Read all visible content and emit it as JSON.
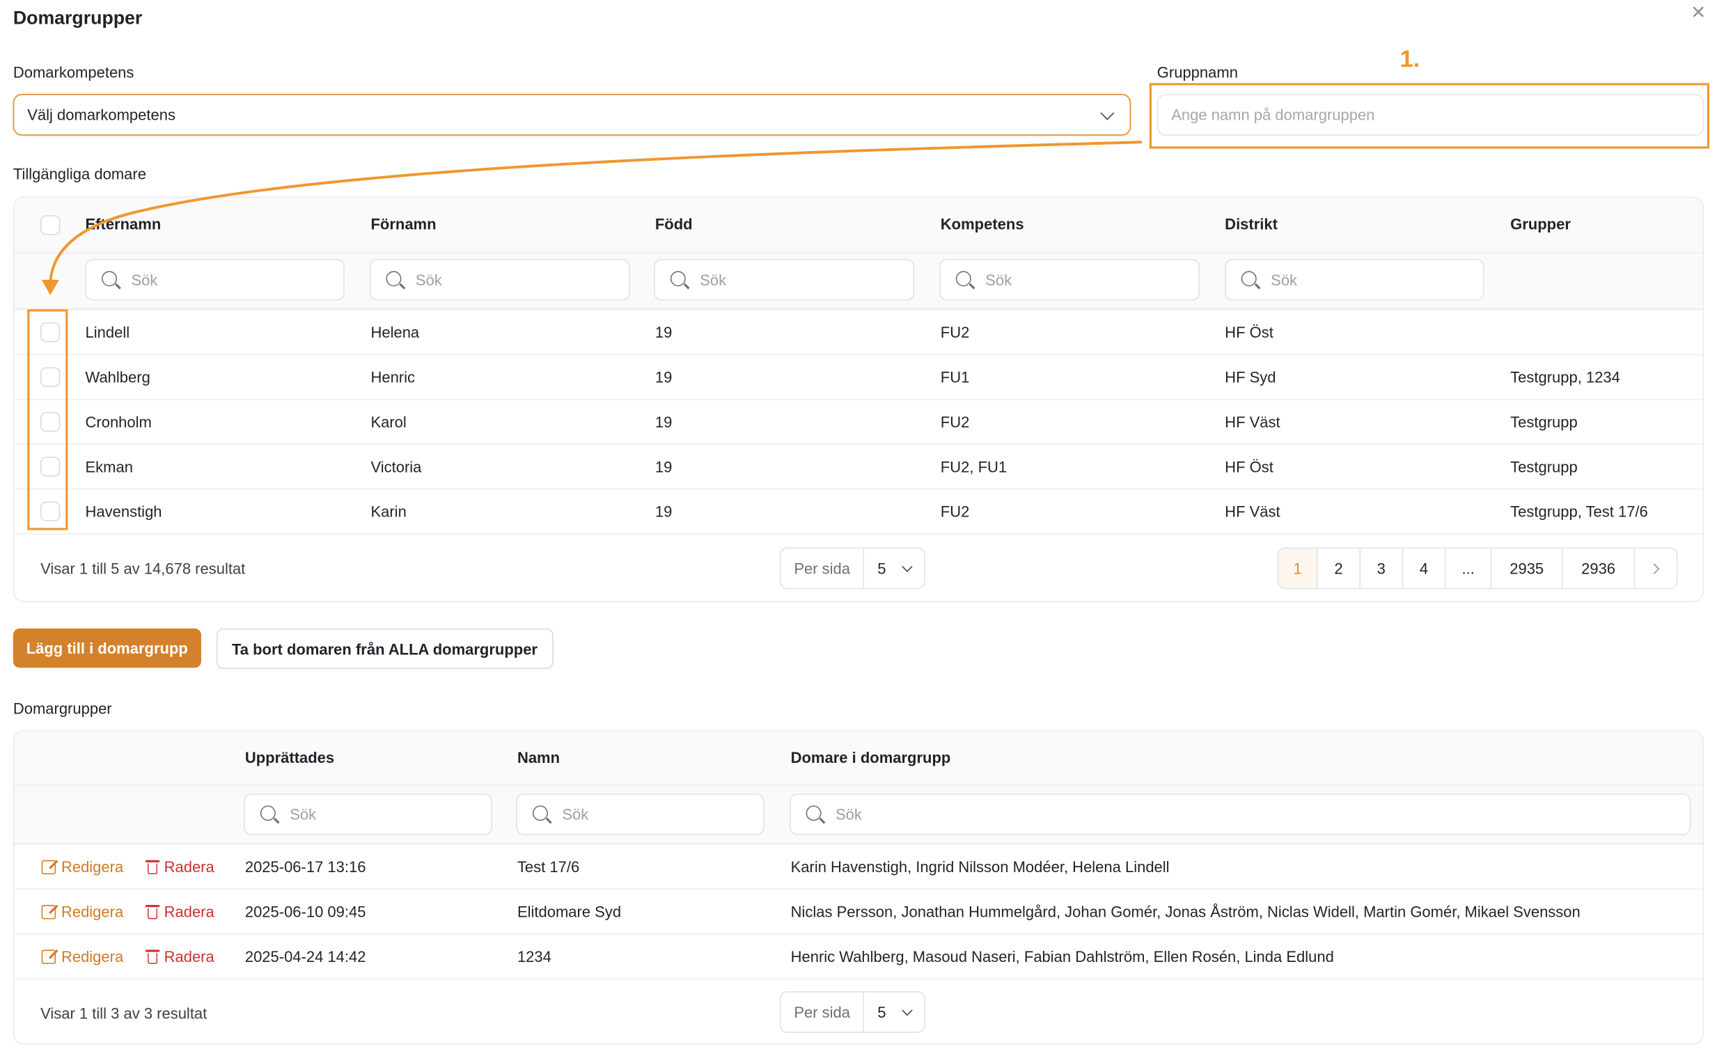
{
  "dialog": {
    "title": "Domargrupper",
    "close_label": "×"
  },
  "form": {
    "competence_label": "Domarkompetens",
    "competence_value": "Välj domarkompetens",
    "group_name_label": "Gruppnamn",
    "group_name_placeholder": "Ange namn på domargruppen",
    "step_marker": "1."
  },
  "available": {
    "section_label": "Tillgängliga domare",
    "columns": [
      "Efternamn",
      "Förnamn",
      "Född",
      "Kompetens",
      "Distrikt",
      "Grupper"
    ],
    "search_placeholder": "Sök",
    "rows": [
      [
        "Lindell",
        "Helena",
        "19",
        "FU2",
        "HF Öst",
        ""
      ],
      [
        "Wahlberg",
        "Henric",
        "19",
        "FU1",
        "HF Syd",
        "Testgrupp, 1234"
      ],
      [
        "Cronholm",
        "Karol",
        "19",
        "FU2",
        "HF Väst",
        "Testgrupp"
      ],
      [
        "Ekman",
        "Victoria",
        "19",
        "FU2, FU1",
        "HF Öst",
        "Testgrupp"
      ],
      [
        "Havenstigh",
        "Karin",
        "19",
        "FU2",
        "HF Väst",
        "Testgrupp, Test 17/6"
      ]
    ],
    "result_text": "Visar 1 till 5 av 14,678 resultat",
    "per_page_label": "Per sida",
    "per_page_value": "5",
    "pages": [
      "1",
      "2",
      "3",
      "4",
      "...",
      "2935",
      "2936"
    ],
    "active_page": "1"
  },
  "actions": {
    "add_label": "Lägg till i domargrupp",
    "remove_all_label": "Ta bort domaren från ALLA domargrupper"
  },
  "groups": {
    "section_label": "Domargrupper",
    "columns": [
      "Upprättades",
      "Namn",
      "Domare i domargrupp"
    ],
    "search_placeholder": "Sök",
    "edit_label": "Redigera",
    "delete_label": "Radera",
    "rows": [
      [
        "2025-06-17 13:16",
        "Test 17/6",
        "Karin Havenstigh, Ingrid Nilsson Modéer, Helena Lindell"
      ],
      [
        "2025-06-10 09:45",
        "Elitdomare Syd",
        "Niclas Persson, Jonathan Hummelgård, Johan Gomér, Jonas Åström, Niclas Widell, Martin Gomér, Mikael Svensson"
      ],
      [
        "2025-04-24 14:42",
        "1234",
        "Henric Wahlberg, Masoud Naseri, Fabian Dahlström, Ellen Rosén, Linda Edlund"
      ]
    ],
    "result_text": "Visar 1 till 3 av 3 resultat",
    "per_page_label": "Per sida",
    "per_page_value": "5"
  },
  "colors": {
    "accent": "#f0972f",
    "primary_button": "#d4812c",
    "delete": "#cf2f2f"
  }
}
